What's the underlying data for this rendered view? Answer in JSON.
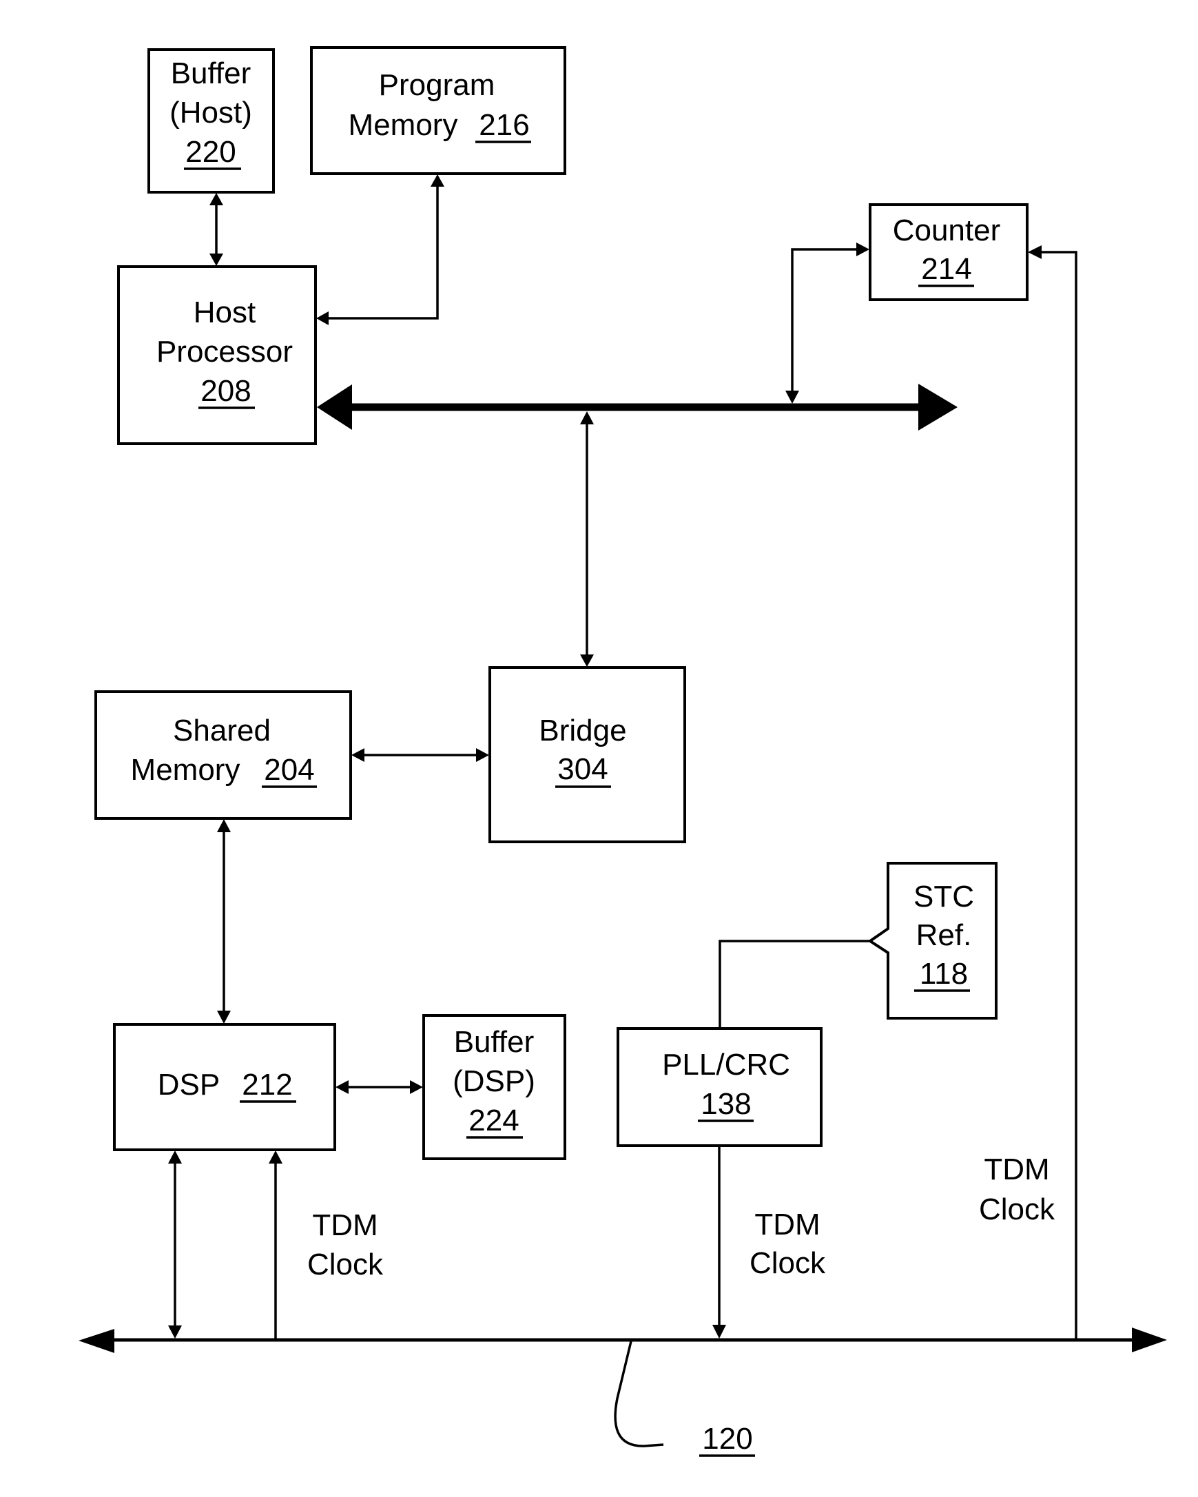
{
  "figure": {
    "type": "block-diagram",
    "blocks": {
      "buffer_host": {
        "lines": [
          "Buffer",
          "(Host)"
        ],
        "ref": "220"
      },
      "program_memory": {
        "lines": [
          "Program",
          "Memory"
        ],
        "ref": "216"
      },
      "host_processor": {
        "lines": [
          "Host",
          "Processor"
        ],
        "ref": "208"
      },
      "counter": {
        "lines": [
          "Counter"
        ],
        "ref": "214"
      },
      "shared_memory": {
        "lines": [
          "Shared",
          "Memory"
        ],
        "ref": "204"
      },
      "bridge": {
        "lines": [
          "Bridge"
        ],
        "ref": "304"
      },
      "dsp": {
        "lines": [
          "DSP"
        ],
        "ref": "212"
      },
      "buffer_dsp": {
        "lines": [
          "Buffer",
          "(DSP)"
        ],
        "ref": "224"
      },
      "stc_ref": {
        "lines": [
          "STC",
          "Ref."
        ],
        "ref": "118"
      },
      "pll_crc": {
        "lines": [
          "PLL/CRC"
        ],
        "ref": "138"
      }
    },
    "labels": {
      "tdm_clock_dsp": [
        "TDM",
        "Clock"
      ],
      "tdm_clock_pll": [
        "TDM",
        "Clock"
      ],
      "tdm_clock_counter": [
        "TDM",
        "Clock"
      ]
    },
    "bus_ref": "120",
    "connections": [
      {
        "from": "buffer_host",
        "to": "host_processor",
        "kind": "bidirectional"
      },
      {
        "from": "program_memory",
        "to": "host_processor",
        "kind": "bidirectional"
      },
      {
        "from": "host_processor",
        "to": "host_bus",
        "kind": "bidirectional"
      },
      {
        "from": "host_bus",
        "to": "counter",
        "kind": "bidirectional"
      },
      {
        "from": "host_bus",
        "to": "bridge",
        "kind": "bidirectional"
      },
      {
        "from": "shared_memory",
        "to": "bridge",
        "kind": "bidirectional"
      },
      {
        "from": "shared_memory",
        "to": "dsp",
        "kind": "bidirectional"
      },
      {
        "from": "dsp",
        "to": "buffer_dsp",
        "kind": "bidirectional"
      },
      {
        "from": "tdm_bus_120",
        "to": "dsp",
        "kind": "bidirectional"
      },
      {
        "from": "tdm_bus_120",
        "to": "dsp",
        "kind": "tdm-clock"
      },
      {
        "from": "stc_ref",
        "to": "pll_crc",
        "kind": "line"
      },
      {
        "from": "pll_crc",
        "to": "tdm_bus_120",
        "kind": "tdm-clock"
      },
      {
        "from": "tdm_bus_120",
        "to": "counter",
        "kind": "tdm-clock"
      }
    ]
  }
}
